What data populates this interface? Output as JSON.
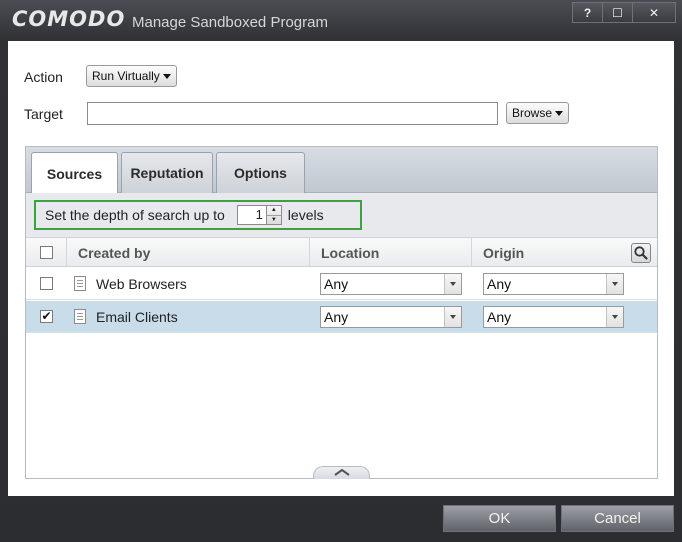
{
  "window": {
    "brand": "COMODO",
    "title": "Manage Sandboxed Program",
    "buttons": {
      "help": "?",
      "maximize": "☐",
      "close": "✕"
    }
  },
  "form": {
    "action_label": "Action",
    "action_value": "Run Virtually",
    "target_label": "Target",
    "target_value": "",
    "browse_label": "Browse"
  },
  "tabs": [
    {
      "label": "Sources",
      "active": true
    },
    {
      "label": "Reputation",
      "active": false
    },
    {
      "label": "Options",
      "active": false
    }
  ],
  "depth": {
    "prefix": "Set the depth of search up to",
    "value": "1",
    "suffix": "levels"
  },
  "table": {
    "columns": [
      "Created by",
      "Location",
      "Origin"
    ],
    "rows": [
      {
        "checked": false,
        "created_by": "Web Browsers",
        "location": "Any",
        "origin": "Any",
        "selected": false
      },
      {
        "checked": true,
        "created_by": "Email Clients",
        "location": "Any",
        "origin": "Any",
        "selected": true
      }
    ]
  },
  "footer": {
    "ok": "OK",
    "cancel": "Cancel"
  },
  "colors": {
    "highlight_box": "#3aa33c",
    "selected_row": "#c8dcea",
    "chrome": "#2b2d31"
  }
}
